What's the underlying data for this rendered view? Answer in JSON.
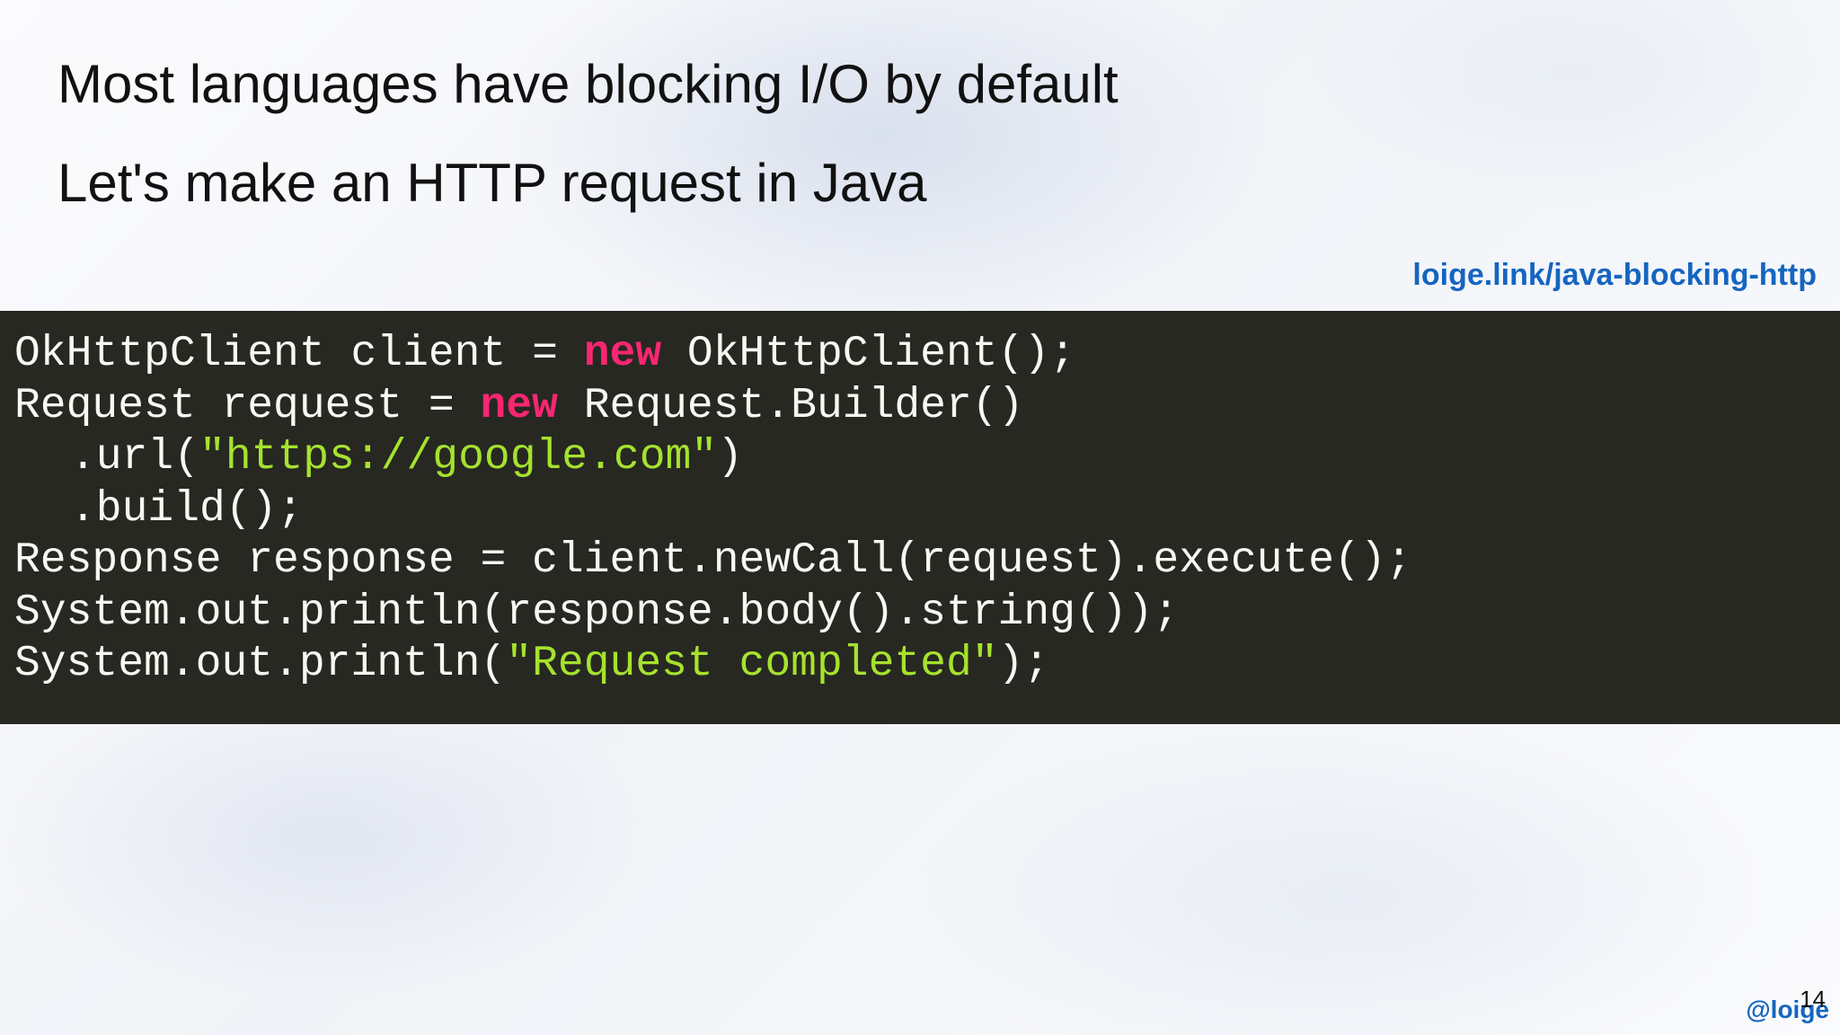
{
  "slide": {
    "line_1": "Most languages have blocking I/O by default",
    "line_2": "Let's make an HTTP request in Java",
    "link_text": "loige.link/java-blocking-http",
    "handle": "@loige",
    "page_number": "14"
  },
  "code": {
    "l1_a": "OkHttpClient client = ",
    "l1_kw": "new",
    "l1_b": " OkHttpClient();",
    "l2_a": "Request request = ",
    "l2_kw": "new",
    "l2_b": " Request.Builder()",
    "l3_a": ".url(",
    "l3_str": "\"https://google.com\"",
    "l3_b": ")",
    "l4": ".build();",
    "l5": "Response response = client.newCall(request).execute();",
    "l6": "System.out.println(response.body().string());",
    "l7_a": "System.out.println(",
    "l7_str": "\"Request completed\"",
    "l7_b": ");"
  },
  "colors": {
    "code_background": "#272822",
    "code_text": "#f8f8f2",
    "keyword": "#f92672",
    "string": "#a6e22e",
    "link": "#1565c0"
  }
}
